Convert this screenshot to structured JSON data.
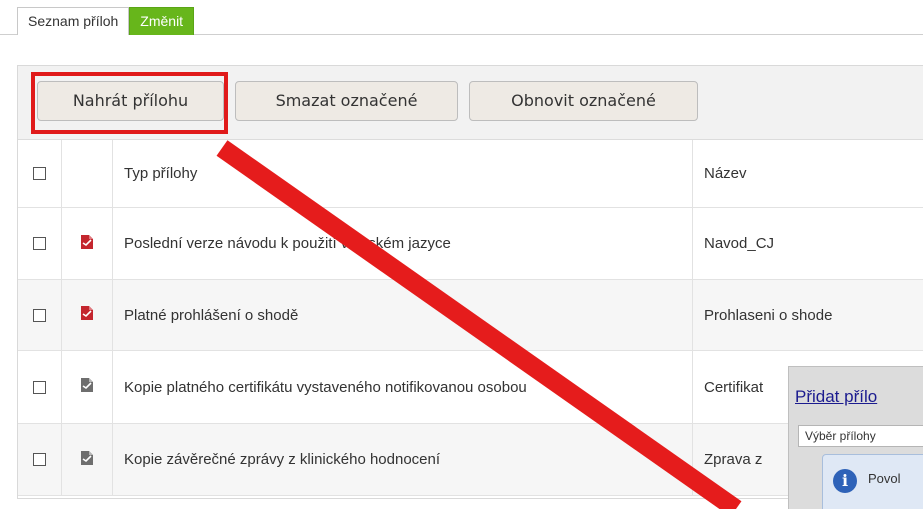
{
  "tabs": {
    "list_label": "Seznam příloh",
    "edit_label": "Změnit"
  },
  "toolbar": {
    "upload_label": "Nahrát přílohu",
    "delete_label": "Smazat označené",
    "renew_label": "Obnovit označené"
  },
  "table": {
    "header": {
      "type": "Typ přílohy",
      "name": "Název"
    },
    "rows": [
      {
        "type": "Poslední verze návodu k použití v českém jazyce",
        "name": "Navod_CJ",
        "icon": "pdf-red-icon",
        "checked": false
      },
      {
        "type": "Platné prohlášení o shodě",
        "name": "Prohlaseni o shode",
        "icon": "pdf-red-icon",
        "checked": false
      },
      {
        "type": "Kopie platného certifikátu vystaveného notifikovanou osobou",
        "name": "Certifikat",
        "icon": "document-gray-icon",
        "checked": false
      },
      {
        "type": "Kopie závěrečné zprávy z klinického hodnocení",
        "name": "Zprava z",
        "icon": "document-gray-icon",
        "checked": false
      }
    ]
  },
  "dialog": {
    "title": "Přidat přílo",
    "select_label": "Výběr přílohy",
    "info_text": "Povol"
  },
  "colors": {
    "accent_green": "#67b61b",
    "highlight_red": "#e01a1a",
    "link_blue": "#1b1b8f"
  }
}
